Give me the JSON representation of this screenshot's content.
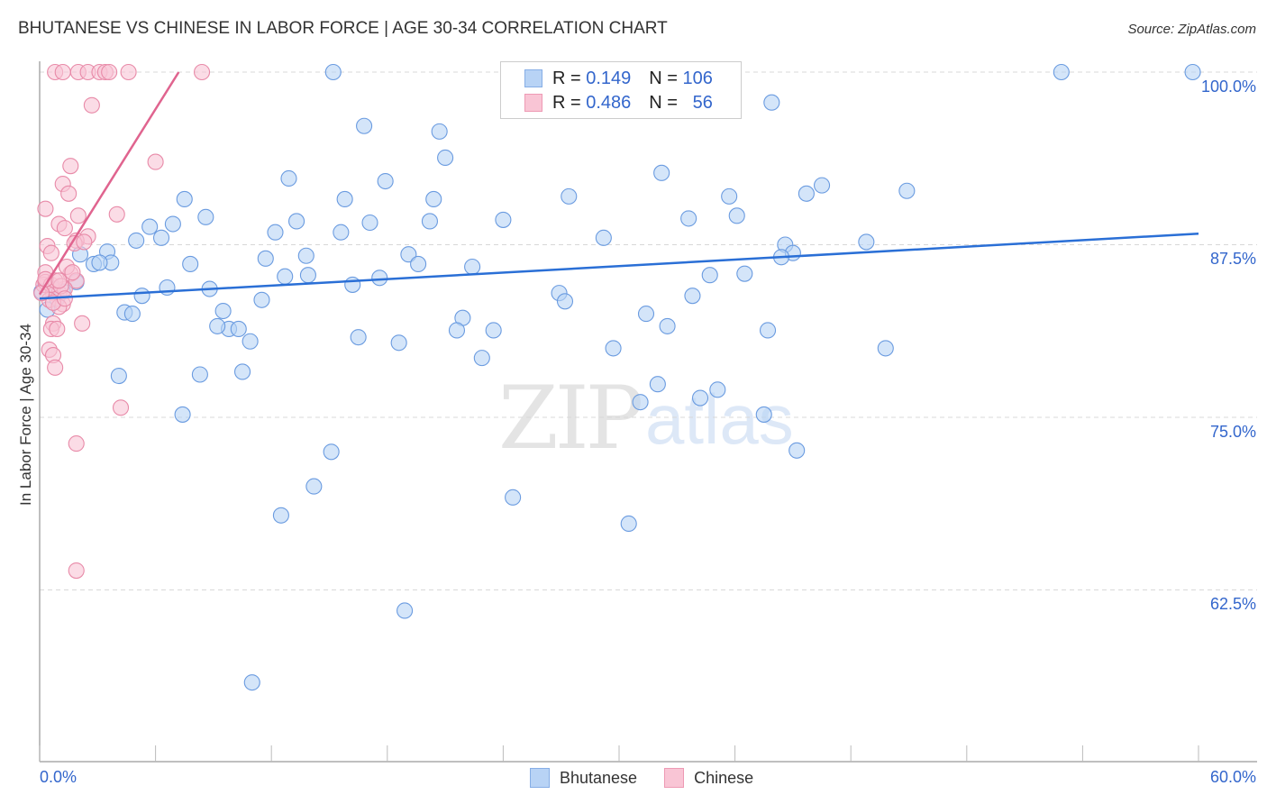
{
  "header": {
    "title": "BHUTANESE VS CHINESE IN LABOR FORCE | AGE 30-34 CORRELATION CHART",
    "source": "Source: ZipAtlas.com"
  },
  "watermark": {
    "zip": "ZIP",
    "atlas": "atlas"
  },
  "legend": {
    "rows": [
      {
        "series": "Bhutanese",
        "r_label": "R =",
        "r_value": "0.149",
        "n_label": "N =",
        "n_value": "106",
        "color": "#b8d3f5"
      },
      {
        "series": "Chinese",
        "r_label": "R =",
        "r_value": "0.486",
        "n_label": "N =",
        "n_value": "56",
        "color": "#f9c5d5"
      }
    ]
  },
  "chart_data": {
    "type": "scatter",
    "title": "BHUTANESE VS CHINESE IN LABOR FORCE | AGE 30-34 CORRELATION CHART",
    "xlabel": "",
    "ylabel": "In Labor Force | Age 30-34",
    "xlim": [
      0,
      60
    ],
    "ylim": [
      51.1,
      101.0
    ],
    "x_tick_labels": [
      "0.0%",
      "60.0%"
    ],
    "x_ticks": [
      0,
      6,
      12,
      18,
      24,
      30,
      36,
      42,
      48,
      54,
      60
    ],
    "y_ticks": [
      100.0,
      87.5,
      75.0,
      62.5
    ],
    "y_tick_labels": [
      "100.0%",
      "87.5%",
      "75.0%",
      "62.5%"
    ],
    "grid": true,
    "legend_position": "top-center",
    "series": [
      {
        "name": "Bhutanese",
        "color": "#6a9be0",
        "fill": "#b8d3f5",
        "R": 0.149,
        "N": 106,
        "trend": {
          "x": [
            0,
            60
          ],
          "y": [
            83.6,
            88.3
          ]
        },
        "points": [
          [
            15.2,
            100.0
          ],
          [
            27.7,
            100.0
          ],
          [
            52.9,
            100.0
          ],
          [
            59.7,
            100.0
          ],
          [
            16.8,
            96.1
          ],
          [
            20.7,
            95.7
          ],
          [
            37.9,
            97.8
          ],
          [
            21.0,
            93.8
          ],
          [
            32.2,
            92.7
          ],
          [
            12.9,
            92.3
          ],
          [
            17.9,
            92.1
          ],
          [
            7.5,
            90.8
          ],
          [
            15.8,
            90.8
          ],
          [
            20.4,
            90.8
          ],
          [
            27.4,
            91.0
          ],
          [
            35.7,
            91.0
          ],
          [
            39.7,
            91.2
          ],
          [
            40.5,
            91.8
          ],
          [
            44.9,
            91.4
          ],
          [
            5.7,
            88.8
          ],
          [
            6.9,
            89.0
          ],
          [
            8.6,
            89.5
          ],
          [
            13.3,
            89.2
          ],
          [
            17.1,
            89.1
          ],
          [
            20.2,
            89.2
          ],
          [
            24.0,
            89.3
          ],
          [
            33.6,
            89.4
          ],
          [
            36.1,
            89.6
          ],
          [
            6.3,
            88.0
          ],
          [
            5.0,
            87.8
          ],
          [
            12.2,
            88.4
          ],
          [
            15.6,
            88.4
          ],
          [
            29.2,
            88.0
          ],
          [
            42.8,
            87.7
          ],
          [
            3.5,
            87.0
          ],
          [
            2.1,
            86.8
          ],
          [
            7.8,
            86.1
          ],
          [
            11.7,
            86.5
          ],
          [
            13.8,
            86.7
          ],
          [
            19.1,
            86.8
          ],
          [
            19.6,
            86.1
          ],
          [
            22.4,
            85.9
          ],
          [
            38.6,
            87.5
          ],
          [
            39.0,
            86.9
          ],
          [
            38.4,
            86.6
          ],
          [
            2.8,
            86.1
          ],
          [
            3.7,
            86.2
          ],
          [
            3.1,
            86.2
          ],
          [
            12.7,
            85.2
          ],
          [
            13.9,
            85.3
          ],
          [
            17.6,
            85.1
          ],
          [
            16.2,
            84.6
          ],
          [
            34.7,
            85.3
          ],
          [
            36.5,
            85.4
          ],
          [
            0.7,
            84.3
          ],
          [
            1.2,
            84.1
          ],
          [
            1.9,
            84.8
          ],
          [
            6.6,
            84.4
          ],
          [
            8.8,
            84.3
          ],
          [
            5.3,
            83.8
          ],
          [
            11.5,
            83.5
          ],
          [
            26.9,
            84.0
          ],
          [
            27.2,
            83.4
          ],
          [
            33.8,
            83.8
          ],
          [
            4.4,
            82.6
          ],
          [
            4.8,
            82.5
          ],
          [
            9.5,
            82.7
          ],
          [
            31.4,
            82.5
          ],
          [
            21.9,
            82.2
          ],
          [
            9.8,
            81.4
          ],
          [
            9.2,
            81.6
          ],
          [
            10.3,
            81.4
          ],
          [
            21.6,
            81.3
          ],
          [
            23.5,
            81.3
          ],
          [
            32.5,
            81.6
          ],
          [
            37.7,
            81.3
          ],
          [
            16.5,
            80.8
          ],
          [
            10.9,
            80.5
          ],
          [
            18.6,
            80.4
          ],
          [
            29.7,
            80.0
          ],
          [
            43.8,
            80.0
          ],
          [
            22.9,
            79.3
          ],
          [
            4.1,
            78.0
          ],
          [
            8.3,
            78.1
          ],
          [
            10.5,
            78.3
          ],
          [
            32.0,
            77.4
          ],
          [
            35.1,
            77.0
          ],
          [
            34.2,
            76.4
          ],
          [
            31.1,
            76.1
          ],
          [
            7.4,
            75.2
          ],
          [
            37.5,
            75.2
          ],
          [
            15.1,
            72.5
          ],
          [
            39.2,
            72.6
          ],
          [
            14.2,
            70.0
          ],
          [
            24.5,
            69.2
          ],
          [
            12.5,
            67.9
          ],
          [
            30.5,
            67.3
          ],
          [
            18.9,
            61.0
          ],
          [
            11.0,
            55.8
          ],
          [
            0.4,
            82.8
          ],
          [
            0.9,
            83.6
          ],
          [
            0.1,
            84.1
          ]
        ]
      },
      {
        "name": "Chinese",
        "color": "#e88aa8",
        "fill": "#f9c5d5",
        "R": 0.486,
        "N": 56,
        "trend": {
          "x": [
            0,
            7.2
          ],
          "y": [
            83.9,
            100.0
          ]
        },
        "points": [
          [
            0.8,
            100.0
          ],
          [
            1.2,
            100.0
          ],
          [
            2.0,
            100.0
          ],
          [
            2.5,
            100.0
          ],
          [
            3.1,
            100.0
          ],
          [
            3.4,
            100.0
          ],
          [
            3.6,
            100.0
          ],
          [
            4.6,
            100.0
          ],
          [
            8.4,
            100.0
          ],
          [
            2.7,
            97.6
          ],
          [
            1.6,
            93.2
          ],
          [
            6.0,
            93.5
          ],
          [
            1.2,
            91.9
          ],
          [
            1.5,
            91.2
          ],
          [
            0.3,
            90.1
          ],
          [
            1.0,
            89.0
          ],
          [
            2.0,
            89.6
          ],
          [
            4.0,
            89.7
          ],
          [
            1.3,
            88.7
          ],
          [
            2.5,
            88.1
          ],
          [
            1.9,
            87.8
          ],
          [
            1.8,
            87.6
          ],
          [
            0.4,
            87.4
          ],
          [
            0.6,
            86.9
          ],
          [
            2.3,
            87.7
          ],
          [
            0.3,
            85.5
          ],
          [
            1.6,
            85.4
          ],
          [
            1.9,
            84.9
          ],
          [
            0.2,
            84.6
          ],
          [
            0.7,
            84.0
          ],
          [
            1.0,
            84.0
          ],
          [
            1.3,
            84.3
          ],
          [
            0.5,
            83.5
          ],
          [
            1.2,
            83.2
          ],
          [
            0.7,
            81.8
          ],
          [
            0.6,
            81.4
          ],
          [
            0.9,
            81.4
          ],
          [
            2.2,
            81.8
          ],
          [
            0.5,
            79.9
          ],
          [
            0.7,
            79.5
          ],
          [
            0.8,
            78.6
          ],
          [
            4.2,
            75.7
          ],
          [
            1.9,
            73.1
          ],
          [
            1.9,
            63.9
          ],
          [
            0.3,
            84.8
          ],
          [
            0.6,
            84.6
          ],
          [
            0.8,
            84.9
          ],
          [
            1.4,
            85.9
          ],
          [
            1.7,
            85.5
          ],
          [
            1.1,
            84.5
          ],
          [
            0.1,
            84.0
          ],
          [
            0.3,
            85.0
          ],
          [
            1.0,
            83.0
          ],
          [
            0.7,
            83.3
          ],
          [
            1.0,
            84.9
          ],
          [
            1.3,
            83.6
          ]
        ]
      }
    ]
  },
  "axes": {
    "y_title": "In Labor Force | Age 30-34",
    "x_min_label": "0.0%",
    "x_max_label": "60.0%",
    "y_labels": [
      "100.0%",
      "87.5%",
      "75.0%",
      "62.5%"
    ]
  },
  "bottom_legend": [
    "Bhutanese",
    "Chinese"
  ]
}
